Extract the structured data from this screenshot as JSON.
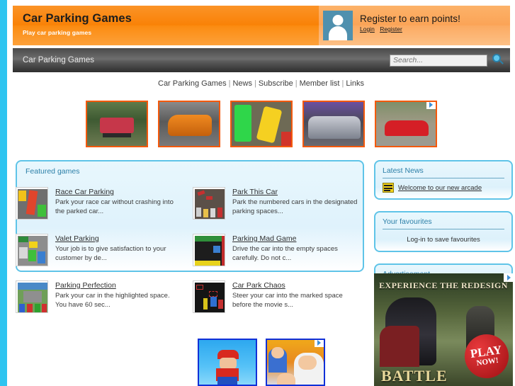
{
  "header": {
    "site_title": "Car Parking Games",
    "tagline": "Play car parking games",
    "register_title": "Register to earn points!",
    "login_label": "Login",
    "register_label": "Register",
    "avatar_icon": "user-silhouette-icon",
    "avatar_color": "#4f90ae"
  },
  "toolbar": {
    "breadcrumb": "Car Parking Games",
    "search_placeholder": "Search...",
    "search_value": "",
    "search_icon": "magnifier-icon"
  },
  "nav": {
    "items": [
      {
        "label": "Car Parking Games"
      },
      {
        "label": "News"
      },
      {
        "label": "Subscribe"
      },
      {
        "label": "Member list"
      },
      {
        "label": "Links"
      }
    ],
    "separator": "|"
  },
  "top_ads": {
    "adchoices_icon": "adchoices-triangle-icon",
    "items": [
      {
        "name": "ad-thumb-buggy"
      },
      {
        "name": "ad-thumb-orange-car"
      },
      {
        "name": "ad-thumb-topdown-parking"
      },
      {
        "name": "ad-thumb-silver-car"
      },
      {
        "name": "ad-thumb-red-car"
      }
    ]
  },
  "featured": {
    "panel_title": "Featured games",
    "games": [
      {
        "title": "Race Car Parking",
        "desc": "Park your race car without crashing into the parked car...",
        "thumb": "race-car-parking-thumb"
      },
      {
        "title": "Park This Car",
        "desc": "Park the numbered cars in the designated parking spaces...",
        "thumb": "park-this-car-thumb"
      },
      {
        "title": "Valet Parking",
        "desc": "Your job is to give satisfaction to your customer by de...",
        "thumb": "valet-parking-thumb"
      },
      {
        "title": "Parking Mad Game",
        "desc": "Drive the car into the empty spaces carefully. Do not c...",
        "thumb": "parking-mad-game-thumb"
      },
      {
        "title": "Parking Perfection",
        "desc": "Park your car in the highlighted space. You have 60 sec...",
        "thumb": "parking-perfection-thumb"
      },
      {
        "title": "Car Park Chaos",
        "desc": "Steer your car into the marked space before the movie s...",
        "thumb": "car-park-chaos-thumb"
      }
    ]
  },
  "sidebar": {
    "news": {
      "title": "Latest News",
      "icon": "newspaper-icon",
      "item_label": "Welcome to our new arcade"
    },
    "favourites": {
      "title": "Your favourites",
      "message": "Log-in to save favourites"
    },
    "advertisement": {
      "title": "Advertisement",
      "ad_headline": "EXPERIENCE THE REDESIGN",
      "ad_brand": "BATTLE",
      "ad_cta_line1": "PLAY",
      "ad_cta_line2": "NOW!",
      "adchoices_icon": "adchoices-triangle-icon"
    }
  },
  "bottom_ads": {
    "adchoices_icon": "adchoices-triangle-icon",
    "items": [
      {
        "name": "ad-thumb-mario"
      },
      {
        "name": "ad-thumb-cartoon-family"
      }
    ]
  },
  "colors": {
    "page_background": "#a6dcf0",
    "header_orange": "#f98207",
    "panel_border": "#5fc4e8",
    "panel_title": "#2b7fa8",
    "ad_border_orange": "#f4590c",
    "ad_border_blue": "#1030d8"
  }
}
